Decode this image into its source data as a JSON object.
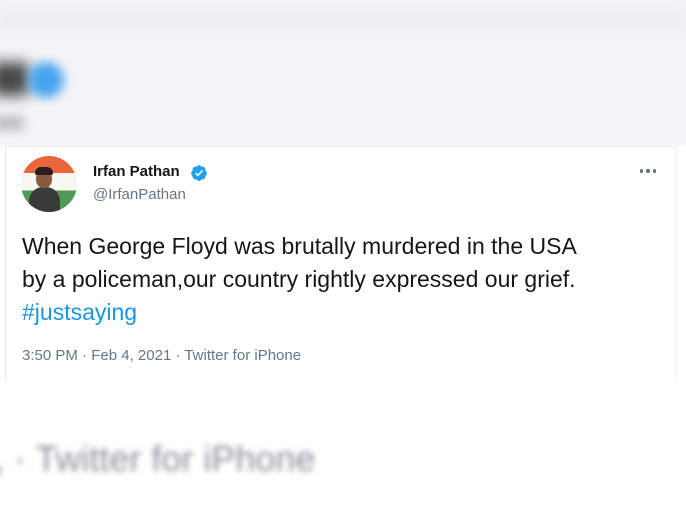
{
  "background": {
    "blurred_bottom_text": ", · Twitter for iPhone"
  },
  "tweet": {
    "author": {
      "name": "Irfan Pathan",
      "handle": "@IrfanPathan",
      "verified": true
    },
    "text_lines": [
      "When George Floyd was brutally murdered in the USA",
      "by a policeman,our country rightly expressed our grief."
    ],
    "hashtag": "#justsaying",
    "time": "3:50 PM",
    "separator": " · ",
    "date": "Feb 4, 2021",
    "source": "Twitter for iPhone"
  },
  "colors": {
    "text": "#14171a",
    "secondary": "#657786",
    "link": "#1b95e0",
    "verified": "#1da1f2"
  },
  "icons": {
    "verified": "verified-badge-icon",
    "more": "more-options-icon"
  }
}
